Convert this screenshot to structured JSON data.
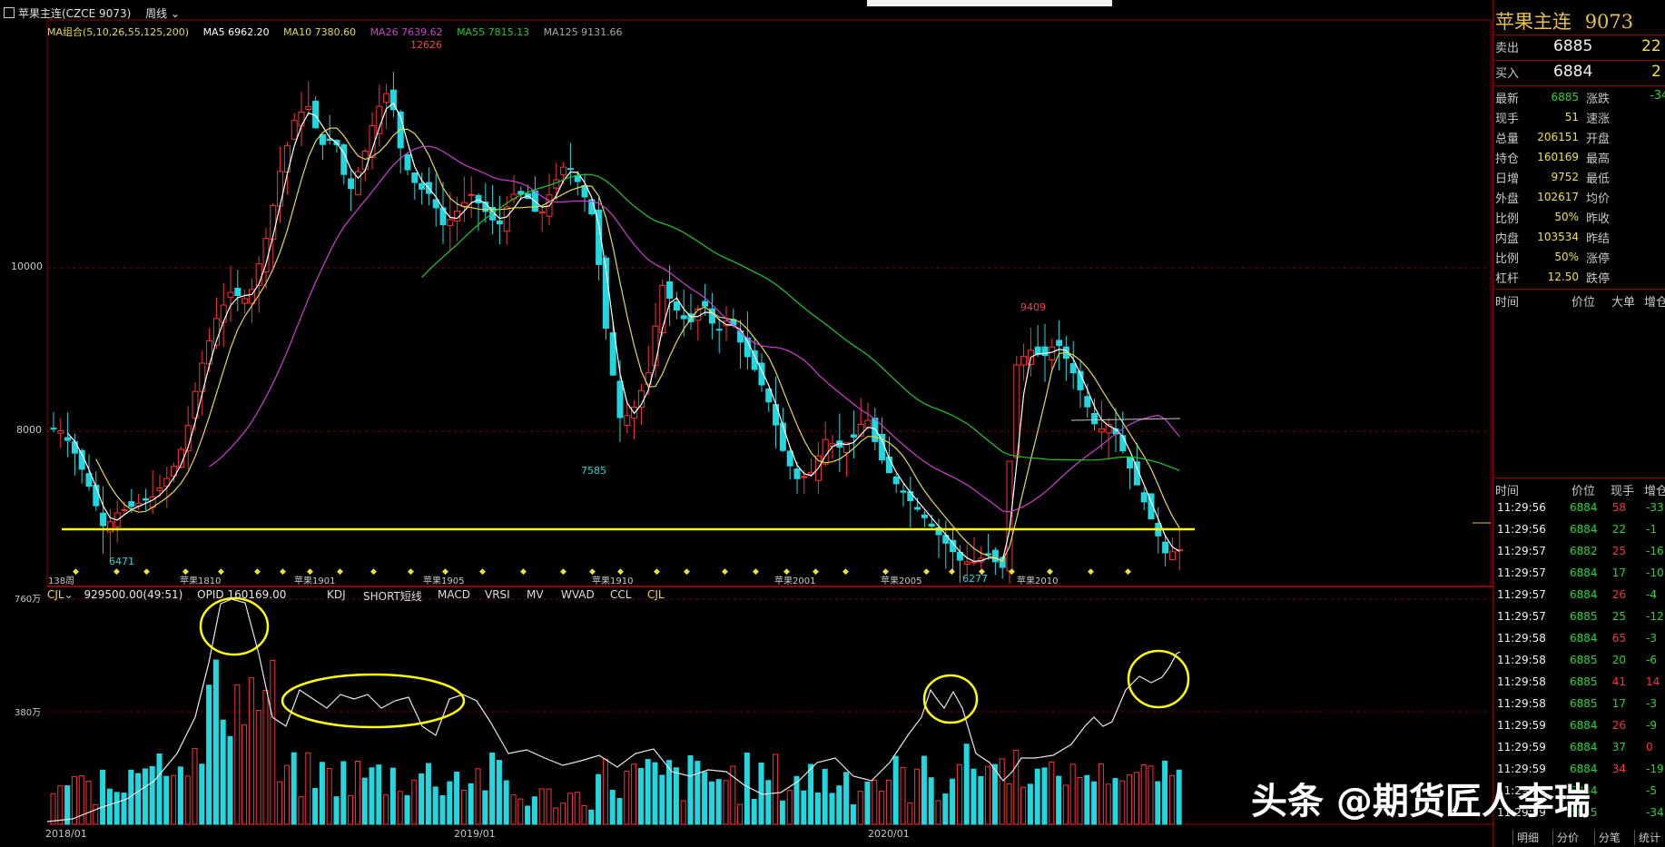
{
  "header": {
    "title": "苹果主连(CZCE 9073)",
    "period": "周线",
    "ma_group": "MA组合(5,10,26,55,125,200)",
    "ma5": "MA5 6962.20",
    "ma10": "MA10 7380.60",
    "ma26": "MA26 7639.62",
    "ma55": "MA55 7815.13",
    "ma125": "MA125 9131.66"
  },
  "chart_data": {
    "type": "candlestick",
    "yticks": [
      "10000",
      "8000"
    ],
    "xticks": [
      "2018/01",
      "2019/01",
      "2020/01"
    ],
    "annotations": {
      "high1": "12626",
      "low1": "6471",
      "low2": "7585",
      "high2": "9409",
      "low3": "6277"
    },
    "contract_labels": [
      "苹果1810",
      "苹果1901",
      "苹果1905",
      "苹果1910",
      "苹果2001",
      "苹果2005",
      "苹果2010"
    ],
    "week_marker": "138周",
    "support_line": 6471,
    "colors": {
      "up": "#ff3232",
      "down": "#22d8e0",
      "ma5": "#ffffff",
      "ma10": "#e8d84a",
      "ma26": "#d23cd2",
      "ma55": "#22c822",
      "ma125": "#c8c8c8",
      "support": "#ffff00"
    }
  },
  "indicator": {
    "name": "CJL",
    "value": "929500.00(49:51)",
    "opid": "OPID 160169.00",
    "ytick_top": "760万",
    "ytick_mid": "380万",
    "tabs": [
      "KDJ",
      "SHORT短线",
      "MACD",
      "VRSI",
      "MV",
      "WVAD",
      "CCL",
      "CJL"
    ]
  },
  "panel": {
    "title": "苹果主连",
    "code": "9073",
    "sell_label": "卖出",
    "sell_price": "6885",
    "sell_vol": "22",
    "buy_label": "买入",
    "buy_price": "6884",
    "buy_vol": "2",
    "stats": [
      {
        "l1": "最新",
        "v1": "6885",
        "l2": "涨跌",
        "v2": "-34"
      },
      {
        "l1": "现手",
        "v1": "51",
        "l2": "速涨",
        "v2": ""
      },
      {
        "l1": "总量",
        "v1": "206151",
        "l2": "开盘",
        "v2": ""
      },
      {
        "l1": "持仓",
        "v1": "160169",
        "l2": "最高",
        "v2": ""
      },
      {
        "l1": "日增",
        "v1": "9752",
        "l2": "最低",
        "v2": ""
      },
      {
        "l1": "外盘",
        "v1": "102617",
        "l2": "均价",
        "v2": ""
      },
      {
        "l1": "比例",
        "v1": "50%",
        "l2": "昨收",
        "v2": ""
      },
      {
        "l1": "内盘",
        "v1": "103534",
        "l2": "昨结",
        "v2": ""
      },
      {
        "l1": "比例",
        "v1": "50%",
        "l2": "涨停",
        "v2": ""
      },
      {
        "l1": "杠杆",
        "v1": "12.50",
        "l2": "跌停",
        "v2": ""
      }
    ],
    "head1": [
      "时间",
      "价位",
      "大单",
      "增仓"
    ],
    "head2": [
      "时间",
      "价位",
      "现手",
      "增仓"
    ],
    "ticks": [
      {
        "t": "11:29:56",
        "p": "6884",
        "v": "58",
        "d": "-33"
      },
      {
        "t": "11:29:56",
        "p": "6884",
        "v": "22",
        "d": "-1"
      },
      {
        "t": "11:29:57",
        "p": "6882",
        "v": "25",
        "d": "-16"
      },
      {
        "t": "11:29:57",
        "p": "6884",
        "v": "17",
        "d": "-10"
      },
      {
        "t": "11:29:57",
        "p": "6884",
        "v": "26",
        "d": "-4"
      },
      {
        "t": "11:29:57",
        "p": "6885",
        "v": "25",
        "d": "-12"
      },
      {
        "t": "11:29:58",
        "p": "6884",
        "v": "65",
        "d": "-3"
      },
      {
        "t": "11:29:58",
        "p": "6885",
        "v": "20",
        "d": "-6"
      },
      {
        "t": "11:29:58",
        "p": "6885",
        "v": "41",
        "d": "14"
      },
      {
        "t": "11:29:58",
        "p": "6885",
        "v": "17",
        "d": "-3"
      },
      {
        "t": "11:29:59",
        "p": "6884",
        "v": "26",
        "d": "-9"
      },
      {
        "t": "11:29:59",
        "p": "6884",
        "v": "37",
        "d": "0"
      },
      {
        "t": "11:29:59",
        "p": "6884",
        "v": "34",
        "d": "-19"
      },
      {
        "t": "11:29:59",
        "p": "6884",
        "v": "",
        "d": "-5"
      },
      {
        "t": "11:29:59",
        "p": "6885",
        "v": "",
        "d": "-34"
      }
    ],
    "tabs": [
      "明细",
      "分价",
      "分笔",
      "统计"
    ]
  },
  "watermark": "头条 @期货匠人李瑞"
}
